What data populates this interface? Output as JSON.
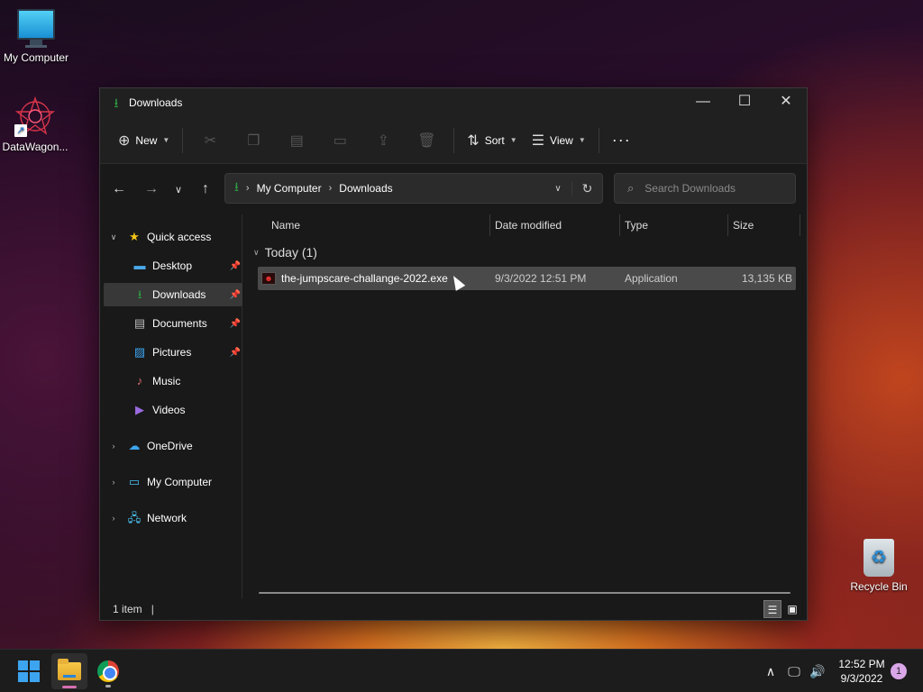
{
  "desktop": {
    "icons": [
      {
        "label": "My Computer"
      },
      {
        "label": "DataWagon..."
      },
      {
        "label": "Recycle Bin"
      }
    ]
  },
  "window": {
    "title": "Downloads",
    "controls": {
      "minimize": "—",
      "maximize": "☐",
      "close": "✕"
    }
  },
  "toolbar": {
    "new_label": "New",
    "sort_label": "Sort",
    "view_label": "View",
    "more_label": "···"
  },
  "address": {
    "crumbs": [
      "My Computer",
      "Downloads"
    ]
  },
  "search": {
    "placeholder": "Search Downloads"
  },
  "sidebar": {
    "items": [
      {
        "label": "Quick access"
      },
      {
        "label": "Desktop"
      },
      {
        "label": "Downloads"
      },
      {
        "label": "Documents"
      },
      {
        "label": "Pictures"
      },
      {
        "label": "Music"
      },
      {
        "label": "Videos"
      },
      {
        "label": "OneDrive"
      },
      {
        "label": "My Computer"
      },
      {
        "label": "Network"
      }
    ]
  },
  "columns": [
    "Name",
    "Date modified",
    "Type",
    "Size"
  ],
  "group": {
    "label": "Today (1)"
  },
  "files": [
    {
      "name": "the-jumpscare-challange-2022.exe",
      "date_modified": "9/3/2022 12:51 PM",
      "type": "Application",
      "size": "13,135 KB"
    }
  ],
  "status": {
    "item_count": "1 item",
    "caret": "|"
  },
  "taskbar": {
    "clock_time": "12:52 PM",
    "clock_date": "9/3/2022",
    "notification_count": "1"
  },
  "colors": {
    "accent_green": "#2ea043",
    "selection": "#4a4a4a",
    "start_blue": "#3da4ef"
  }
}
